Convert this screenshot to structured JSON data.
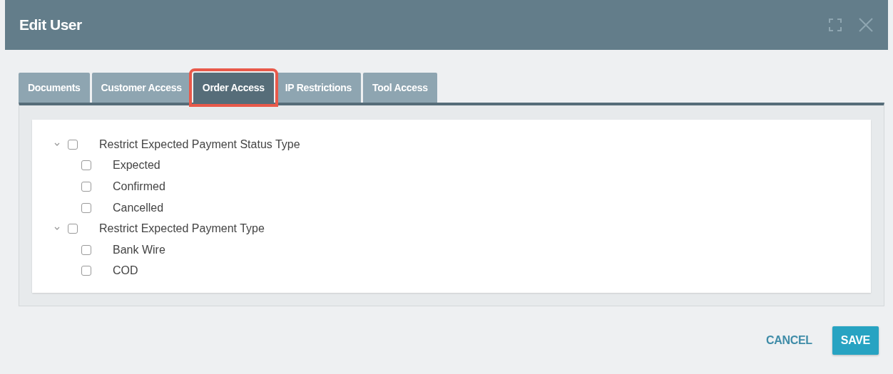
{
  "window": {
    "title": "Edit User"
  },
  "tabs": [
    {
      "label": "Documents",
      "selected": false,
      "highlighted": false
    },
    {
      "label": "Customer Access",
      "selected": false,
      "highlighted": false
    },
    {
      "label": "Order Access",
      "selected": true,
      "highlighted": true
    },
    {
      "label": "IP Restrictions",
      "selected": false,
      "highlighted": false
    },
    {
      "label": "Tool Access",
      "selected": false,
      "highlighted": false
    }
  ],
  "tree": [
    {
      "label": "Restrict Expected Payment Status Type",
      "checked": false,
      "expanded": true,
      "children": [
        {
          "label": "Expected",
          "checked": false
        },
        {
          "label": "Confirmed",
          "checked": false
        },
        {
          "label": "Cancelled",
          "checked": false
        }
      ]
    },
    {
      "label": "Restrict Expected Payment Type",
      "checked": false,
      "expanded": true,
      "children": [
        {
          "label": "Bank Wire",
          "checked": false
        },
        {
          "label": "COD",
          "checked": false
        }
      ]
    }
  ],
  "buttons": [
    {
      "label": "CANCEL",
      "kind": "text"
    },
    {
      "label": "SAVE",
      "kind": "primary"
    }
  ]
}
